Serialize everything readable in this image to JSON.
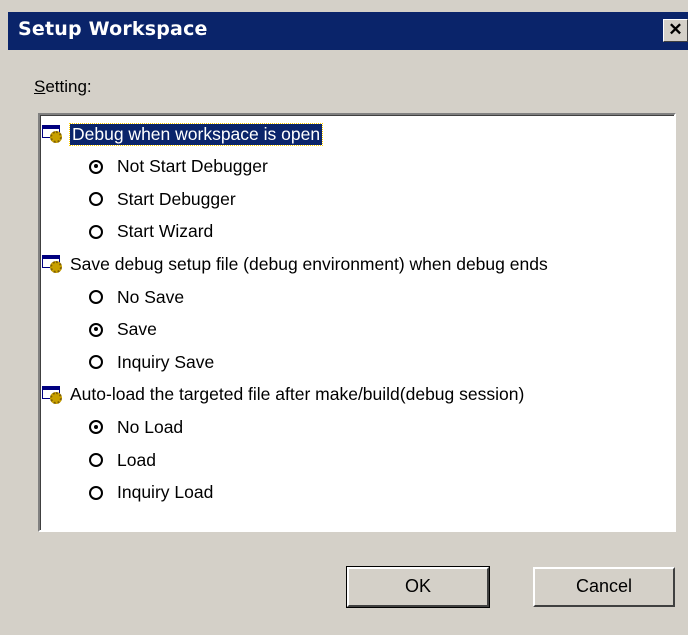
{
  "window": {
    "title": "Setup Workspace",
    "close_label": "✕"
  },
  "setting_label": "Setting:",
  "groups": [
    {
      "label": "Debug when workspace is open",
      "selected": true,
      "options": [
        {
          "label": "Not Start Debugger",
          "checked": true
        },
        {
          "label": "Start Debugger",
          "checked": false
        },
        {
          "label": "Start Wizard",
          "checked": false
        }
      ]
    },
    {
      "label": "Save debug setup file (debug environment) when debug ends",
      "selected": false,
      "options": [
        {
          "label": "No Save",
          "checked": false
        },
        {
          "label": "Save",
          "checked": true
        },
        {
          "label": "Inquiry Save",
          "checked": false
        }
      ]
    },
    {
      "label": "Auto-load the targeted file after make/build(debug session)",
      "selected": false,
      "options": [
        {
          "label": "No Load",
          "checked": true
        },
        {
          "label": "Load",
          "checked": false
        },
        {
          "label": "Inquiry Load",
          "checked": false
        }
      ]
    }
  ],
  "buttons": {
    "ok": "OK",
    "cancel": "Cancel"
  },
  "icons": {
    "group": "settings-group-icon",
    "close": "close-icon"
  },
  "colors": {
    "titlebar": "#0a246a",
    "face": "#d4d0c8",
    "selection": "#0a246a"
  }
}
